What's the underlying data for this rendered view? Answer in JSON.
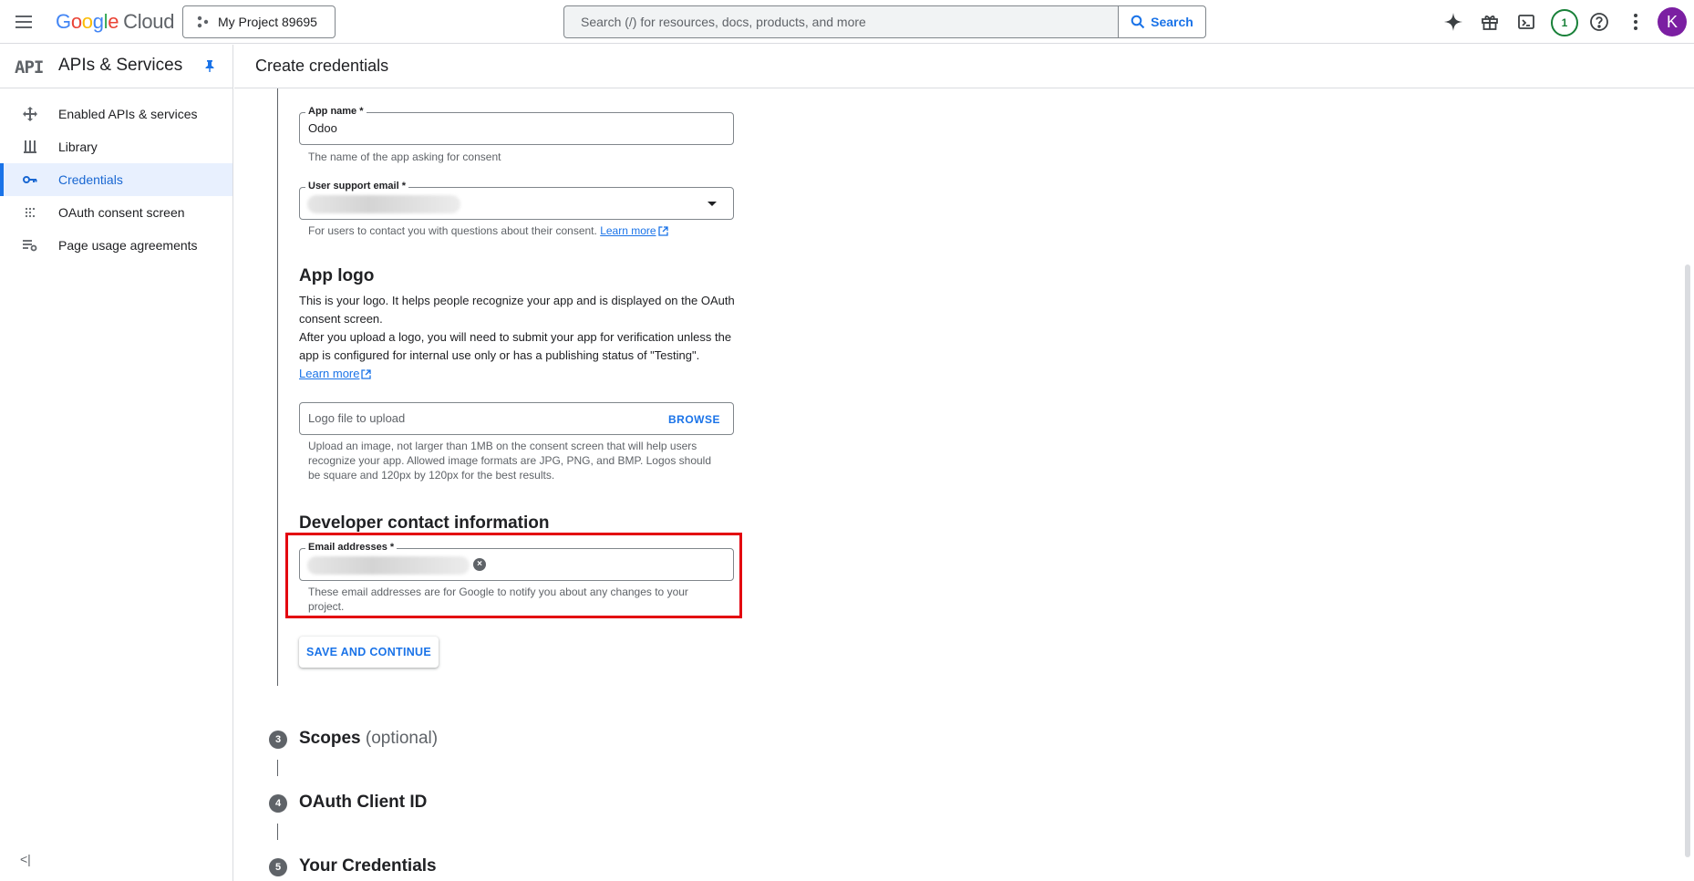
{
  "topbar": {
    "logo_letters": [
      "G",
      "o",
      "o",
      "g",
      "l",
      "e"
    ],
    "logo_suffix": "Cloud",
    "project": "My Project 89695",
    "search_placeholder": "Search (/) for resources, docs, products, and more",
    "search_button": "Search",
    "notification_count": "1",
    "avatar_initial": "K",
    "icons": [
      "gemini-spark-icon",
      "gift-icon",
      "terminal-icon",
      "help-icon",
      "more-vert-icon"
    ]
  },
  "sidebar": {
    "api_mark": "API",
    "title": "APIs & Services",
    "items": [
      {
        "label": "Enabled APIs & services",
        "icon": "move-icon"
      },
      {
        "label": "Library",
        "icon": "library-icon"
      },
      {
        "label": "Credentials",
        "icon": "key-icon",
        "active": true
      },
      {
        "label": "OAuth consent screen",
        "icon": "dots-grid-icon"
      },
      {
        "label": "Page usage agreements",
        "icon": "settings-list-icon"
      }
    ],
    "collapse_glyph": "<|"
  },
  "page": {
    "title": "Create credentials",
    "app_name": {
      "label": "App name *",
      "value": "Odoo",
      "hint": "The name of the app asking for consent"
    },
    "support_email": {
      "label": "User support email *",
      "hint": "For users to contact you with questions about their consent.",
      "link": "Learn more"
    },
    "app_logo": {
      "heading": "App logo",
      "para1": "This is your logo. It helps people recognize your app and is displayed on the OAuth consent screen.",
      "para2": "After you upload a logo, you will need to submit your app for verification unless the app is configured for internal use only or has a publishing status of \"Testing\".",
      "link": "Learn more",
      "upload_placeholder": "Logo file to upload",
      "browse": "BROWSE",
      "hint": "Upload an image, not larger than 1MB on the consent screen that will help users recognize your app. Allowed image formats are JPG, PNG, and BMP. Logos should be square and 120px by 120px for the best results."
    },
    "developer": {
      "heading": "Developer contact information",
      "label": "Email addresses *",
      "hint": "These email addresses are for Google to notify you about any changes to your project."
    },
    "save_button": "SAVE AND CONTINUE",
    "steps": [
      {
        "num": "3",
        "title": "Scopes",
        "suffix": "(optional)"
      },
      {
        "num": "4",
        "title": "OAuth Client ID"
      },
      {
        "num": "5",
        "title": "Your Credentials"
      }
    ],
    "colors": {
      "accent": "#1a73e8",
      "highlight_box": "#e3000f"
    }
  }
}
